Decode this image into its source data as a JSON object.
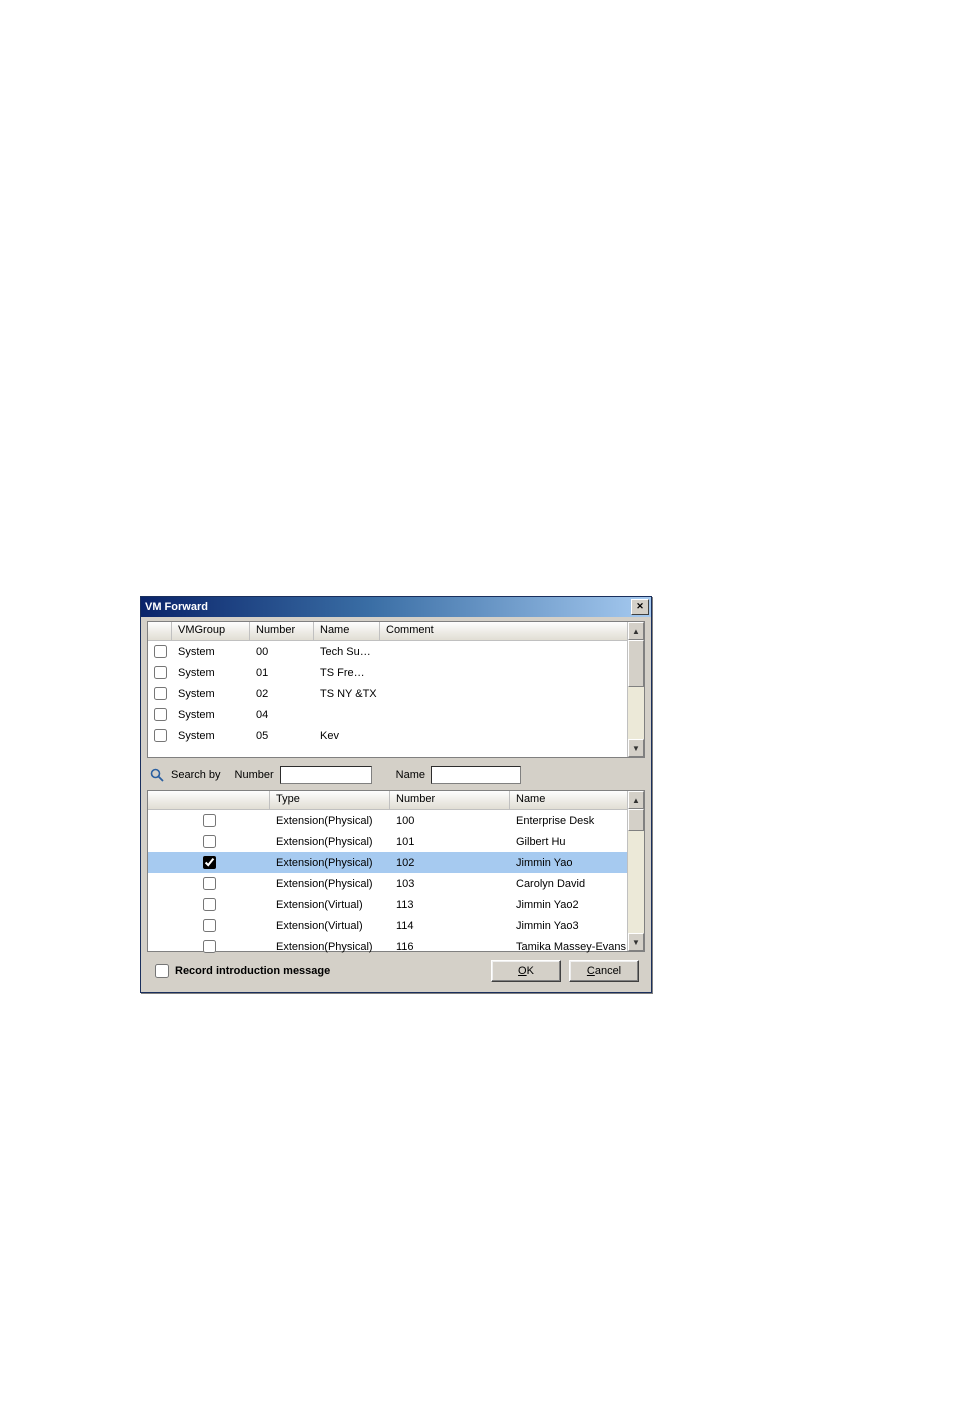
{
  "window": {
    "title": "VM Forward"
  },
  "topTable": {
    "headers": {
      "vmgroup": "VMGroup",
      "number": "Number",
      "name": "Name",
      "comment": "Comment"
    },
    "rows": [
      {
        "checked": false,
        "vmgroup": "System",
        "number": "00",
        "name": "Tech Su…",
        "comment": ""
      },
      {
        "checked": false,
        "vmgroup": "System",
        "number": "01",
        "name": "TS Fre…",
        "comment": ""
      },
      {
        "checked": false,
        "vmgroup": "System",
        "number": "02",
        "name": "TS NY &TX",
        "comment": ""
      },
      {
        "checked": false,
        "vmgroup": "System",
        "number": "04",
        "name": "",
        "comment": ""
      },
      {
        "checked": false,
        "vmgroup": "System",
        "number": "05",
        "name": "Kev",
        "comment": ""
      }
    ]
  },
  "search": {
    "label": "Search by",
    "numberLabel": "Number",
    "nameLabel": "Name",
    "numberValue": "",
    "nameValue": ""
  },
  "bottomTable": {
    "headers": {
      "type": "Type",
      "number": "Number",
      "name": "Name"
    },
    "rows": [
      {
        "checked": false,
        "selected": false,
        "type": "Extension(Physical)",
        "number": "100",
        "name": "Enterprise Desk"
      },
      {
        "checked": false,
        "selected": false,
        "type": "Extension(Physical)",
        "number": "101",
        "name": "Gilbert Hu"
      },
      {
        "checked": true,
        "selected": true,
        "type": "Extension(Physical)",
        "number": "102",
        "name": "Jimmin Yao"
      },
      {
        "checked": false,
        "selected": false,
        "type": "Extension(Physical)",
        "number": "103",
        "name": "Carolyn David"
      },
      {
        "checked": false,
        "selected": false,
        "type": "Extension(Virtual)",
        "number": "113",
        "name": "Jimmin Yao2"
      },
      {
        "checked": false,
        "selected": false,
        "type": "Extension(Virtual)",
        "number": "114",
        "name": "Jimmin Yao3"
      },
      {
        "checked": false,
        "selected": false,
        "type": "Extension(Physical)",
        "number": "116",
        "name": "Tamika Massey-Evans"
      }
    ]
  },
  "footer": {
    "recordIntroLabel": "Record introduction message",
    "recordIntroChecked": false,
    "okLetter": "O",
    "okRest": "K",
    "cancelLetter": "C",
    "cancelRest": "ancel"
  }
}
